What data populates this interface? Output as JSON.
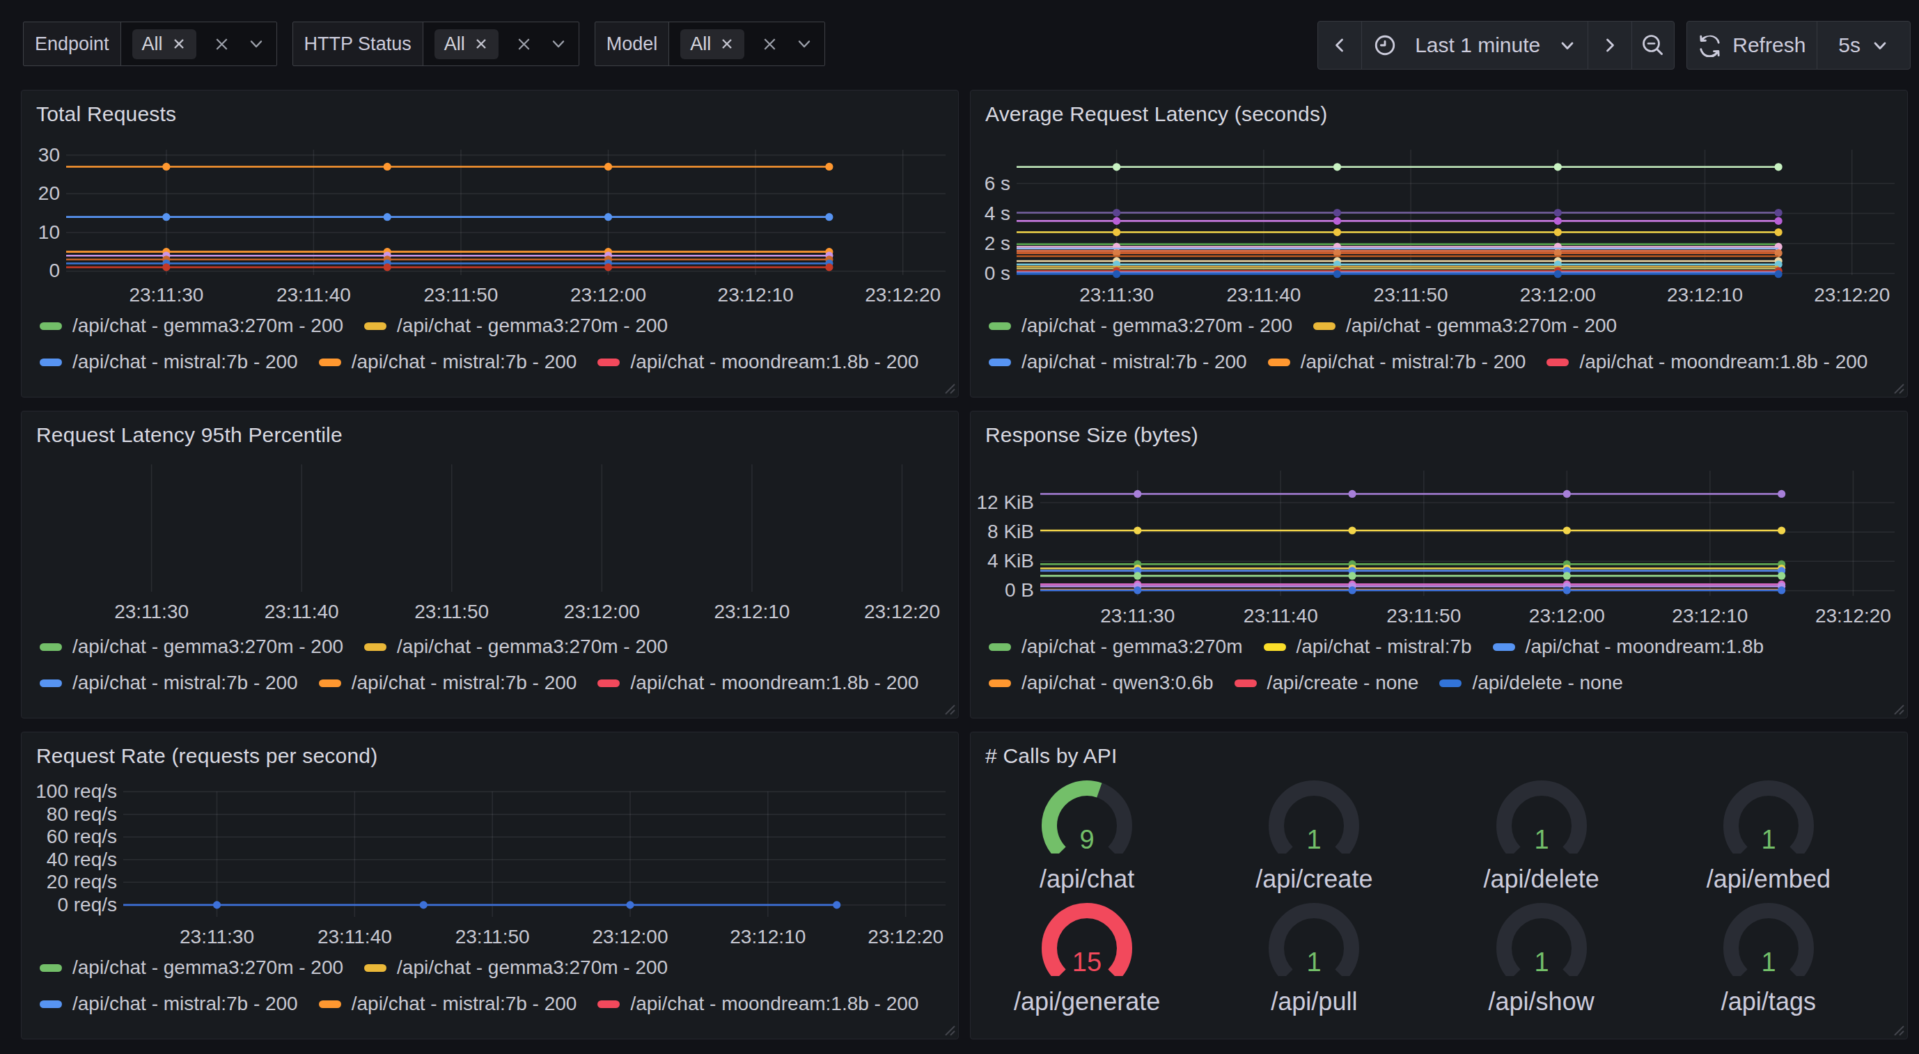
{
  "colors": {
    "page_bg": "#111217",
    "panel_bg": "#181B1F",
    "panel_border": "#25272E",
    "grid_line": "rgba(204,204,220,0.10)",
    "text": "#CCCCDC",
    "tick_text": "#C8C9D3",
    "green": "#73BF69",
    "red": "#F2495C"
  },
  "filters": [
    {
      "label": "Endpoint",
      "selected": "All"
    },
    {
      "label": "HTTP Status",
      "selected": "All"
    },
    {
      "label": "Model",
      "selected": "All"
    }
  ],
  "timebar": {
    "time_range": "Last 1 minute",
    "refresh_label": "Refresh",
    "interval": "5s"
  },
  "chart_data": [
    {
      "type": "line",
      "title": "Total Requests",
      "x_tick_labels": [
        "23:11:30",
        "23:11:40",
        "23:11:50",
        "23:12:00",
        "23:12:10",
        "23:12:20"
      ],
      "x_tick_times": [
        10,
        20,
        30,
        40,
        50,
        60
      ],
      "x_domain": [
        3.2,
        62.9
      ],
      "point_times": [
        10,
        25,
        40,
        55
      ],
      "point_labels": [
        "23:11:30",
        "23:11:45",
        "23:12:00",
        "23:12:15"
      ],
      "y_ticks": [
        {
          "v": 0,
          "label": "0"
        },
        {
          "v": 10,
          "label": "10"
        },
        {
          "v": 20,
          "label": "20"
        },
        {
          "v": 30,
          "label": "30"
        }
      ],
      "ylim": [
        -1.0,
        31.4
      ],
      "gutter": 64,
      "h_grid": true,
      "series": [
        {
          "color": "#FF9830",
          "value": 27
        },
        {
          "color": "#5794F2",
          "value": 14
        },
        {
          "color": "#FF9830",
          "value": 5.0
        },
        {
          "color": "#CA95E5",
          "value": 4.0
        },
        {
          "color": "#C9662B",
          "value": 3.0
        },
        {
          "color": "#3871CC",
          "value": 2.0
        },
        {
          "color": "#C23826",
          "value": 1.0
        }
      ],
      "legend_rows": [
        [
          {
            "color": "#73BF69",
            "label": "/api/chat - gemma3:270m - 200"
          },
          {
            "color": "#EAB839",
            "label": "/api/chat - gemma3:270m - 200"
          }
        ],
        [
          {
            "color": "#5794F2",
            "label": "/api/chat - mistral:7b - 200"
          },
          {
            "color": "#FF9830",
            "label": "/api/chat - mistral:7b - 200"
          },
          {
            "color": "#F2495C",
            "label": "/api/chat - moondream:1.8b - 200"
          }
        ]
      ]
    },
    {
      "type": "line",
      "title": "Average Request Latency (seconds)",
      "x_tick_labels": [
        "23:11:30",
        "23:11:40",
        "23:11:50",
        "23:12:00",
        "23:12:10",
        "23:12:20"
      ],
      "x_tick_times": [
        10,
        20,
        30,
        40,
        50,
        60
      ],
      "x_domain": [
        3.2,
        62.9
      ],
      "point_times": [
        10,
        25,
        40,
        55
      ],
      "point_labels": [
        "23:11:30",
        "23:11:45",
        "23:12:00",
        "23:12:15"
      ],
      "y_ticks": [
        {
          "v": 0,
          "label": "0 s"
        },
        {
          "v": 2,
          "label": "2 s"
        },
        {
          "v": 4,
          "label": "4 s"
        },
        {
          "v": 6,
          "label": "6 s"
        }
      ],
      "ylim": [
        -0.1,
        8.25
      ],
      "gutter": 66,
      "h_grid": true,
      "series": [
        {
          "color": "#C8F2C2",
          "value": 7.1
        },
        {
          "color": "#7661A1",
          "value": 4.05,
          "dot_color": "#5B4490"
        },
        {
          "color": "#C478DC",
          "value": 3.5,
          "dot_color": "#B75FD6"
        },
        {
          "color": "#F2D54A",
          "value": 2.75,
          "dot_color": "#EFC53D"
        },
        {
          "color": "#56A64B",
          "value": 1.95,
          "dots": false
        },
        {
          "color": "#EFB3DA",
          "value": 1.78
        },
        {
          "color": "#94B6F0",
          "value": 1.66,
          "dots": false
        },
        {
          "color": "#F2774A",
          "value": 1.5,
          "dots": false
        },
        {
          "color": "#E8682F",
          "value": 1.36,
          "dot_color": "#D97C45"
        },
        {
          "color": "#BF5B21",
          "value": 1.15,
          "dots": false
        },
        {
          "color": "#EDD7A4",
          "value": 0.83
        },
        {
          "color": "#6FC6DB",
          "value": 0.6
        },
        {
          "color": "#D4A73C",
          "value": 0.46,
          "dots": false
        },
        {
          "color": "#BFBC6B",
          "value": 0.33,
          "dots": false
        },
        {
          "color": "#C23B2B",
          "value": 0.17
        },
        {
          "color": "#9B86C7",
          "value": 0.08,
          "dots": false
        },
        {
          "color": "#4377D9",
          "value": 0.02,
          "dots": false
        },
        {
          "color": "#2159B5",
          "value": -0.04
        }
      ],
      "legend_rows": [
        [
          {
            "color": "#73BF69",
            "label": "/api/chat - gemma3:270m - 200"
          },
          {
            "color": "#EAB839",
            "label": "/api/chat - gemma3:270m - 200"
          }
        ],
        [
          {
            "color": "#5794F2",
            "label": "/api/chat - mistral:7b - 200"
          },
          {
            "color": "#FF9830",
            "label": "/api/chat - mistral:7b - 200"
          },
          {
            "color": "#F2495C",
            "label": "/api/chat - moondream:1.8b - 200"
          }
        ]
      ]
    },
    {
      "type": "line",
      "title": "Request Latency 95th Percentile",
      "x_tick_labels": [
        "23:11:30",
        "23:11:40",
        "23:11:50",
        "23:12:00",
        "23:12:10",
        "23:12:20"
      ],
      "x_tick_times": [
        10,
        20,
        30,
        40,
        50,
        60
      ],
      "x_domain": [
        3.2,
        62.9
      ],
      "point_times": [],
      "point_labels": [],
      "y_ticks": [],
      "ylim": [
        0,
        1
      ],
      "gutter": 40,
      "pt": 76,
      "pb": 259,
      "h_grid": false,
      "series": [],
      "legend_rows": [
        [
          {
            "color": "#73BF69",
            "label": "/api/chat - gemma3:270m - 200"
          },
          {
            "color": "#EAB839",
            "label": "/api/chat - gemma3:270m - 200"
          }
        ],
        [
          {
            "color": "#5794F2",
            "label": "/api/chat - mistral:7b - 200"
          },
          {
            "color": "#FF9830",
            "label": "/api/chat - mistral:7b - 200"
          },
          {
            "color": "#F2495C",
            "label": "/api/chat - moondream:1.8b - 200"
          }
        ]
      ]
    },
    {
      "type": "line",
      "title": "Response Size (bytes)",
      "x_tick_labels": [
        "23:11:30",
        "23:11:40",
        "23:11:50",
        "23:12:00",
        "23:12:10",
        "23:12:20"
      ],
      "x_tick_times": [
        10,
        20,
        30,
        40,
        50,
        60
      ],
      "x_domain": [
        3.2,
        62.9
      ],
      "point_times": [
        10,
        25,
        40,
        55
      ],
      "point_labels": [
        "23:11:30",
        "23:11:45",
        "23:12:00",
        "23:12:15"
      ],
      "y_ticks": [
        {
          "v": 0,
          "label": "0 B"
        },
        {
          "v": 4096,
          "label": "4 KiB"
        },
        {
          "v": 8192,
          "label": "8 KiB"
        },
        {
          "v": 12288,
          "label": "12 KiB"
        }
      ],
      "ylim": [
        -730,
        16750
      ],
      "gutter": 100,
      "h_grid": true,
      "series": [
        {
          "color": "#A77FD9",
          "value": 13500
        },
        {
          "color": "#F2D54A",
          "value": 8400
        },
        {
          "color": "#5FA653",
          "value": 3700
        },
        {
          "color": "#EDD54C",
          "value": 3100
        },
        {
          "color": "#5285E8",
          "value": 2780
        },
        {
          "color": "#96D98D",
          "value": 2070
        },
        {
          "color": "#D96BC9",
          "value": 880
        },
        {
          "color": "#B990E8",
          "value": 600
        },
        {
          "color": "#FF9830",
          "value": 140,
          "dots": false
        },
        {
          "color": "#3D71D9",
          "value": 50
        }
      ],
      "legend_rows": [
        [
          {
            "color": "#73BF69",
            "label": "/api/chat - gemma3:270m"
          },
          {
            "color": "#FADE2A",
            "label": "/api/chat - mistral:7b"
          },
          {
            "color": "#5794F2",
            "label": "/api/chat - moondream:1.8b"
          }
        ],
        [
          {
            "color": "#FF9830",
            "label": "/api/chat - qwen3:0.6b"
          },
          {
            "color": "#F2495C",
            "label": "/api/create - none"
          },
          {
            "color": "#3274D9",
            "label": "/api/delete - none"
          }
        ]
      ]
    },
    {
      "type": "line",
      "title": "Request Rate (requests per second)",
      "x_tick_labels": [
        "23:11:30",
        "23:11:40",
        "23:11:50",
        "23:12:00",
        "23:12:10",
        "23:12:20"
      ],
      "x_tick_times": [
        10,
        20,
        30,
        40,
        50,
        60
      ],
      "x_domain": [
        3.2,
        62.9
      ],
      "point_times": [
        10,
        25,
        40,
        55
      ],
      "point_labels": [
        "23:11:30",
        "23:11:45",
        "23:12:00",
        "23:12:15"
      ],
      "y_ticks": [
        {
          "v": 0,
          "label": "0 req/s"
        },
        {
          "v": 20,
          "label": "20 req/s"
        },
        {
          "v": 40,
          "label": "40 req/s"
        },
        {
          "v": 60,
          "label": "60 req/s"
        },
        {
          "v": 80,
          "label": "80 req/s"
        },
        {
          "v": 100,
          "label": "100 req/s"
        }
      ],
      "ylim": [
        -10.5,
        100.1
      ],
      "gutter": 146,
      "h_grid": true,
      "series": [
        {
          "color": "#3D71D9",
          "value": 0
        }
      ],
      "legend_rows": [
        [
          {
            "color": "#73BF69",
            "label": "/api/chat - gemma3:270m - 200"
          },
          {
            "color": "#EAB839",
            "label": "/api/chat - gemma3:270m - 200"
          }
        ],
        [
          {
            "color": "#5794F2",
            "label": "/api/chat - mistral:7b - 200"
          },
          {
            "color": "#FF9830",
            "label": "/api/chat - mistral:7b - 200"
          },
          {
            "color": "#F2495C",
            "label": "/api/chat - moondream:1.8b - 200"
          }
        ]
      ]
    },
    {
      "type": "gauge",
      "title": "# Calls by API",
      "min": 1,
      "max": 15,
      "gauges": [
        {
          "label": "/api/chat",
          "value": 9,
          "color": "#73BF69"
        },
        {
          "label": "/api/create",
          "value": 1,
          "color": "#73BF69"
        },
        {
          "label": "/api/delete",
          "value": 1,
          "color": "#73BF69"
        },
        {
          "label": "/api/embed",
          "value": 1,
          "color": "#73BF69"
        },
        {
          "label": "/api/generate",
          "value": 15,
          "color": "#F2495C"
        },
        {
          "label": "/api/pull",
          "value": 1,
          "color": "#73BF69"
        },
        {
          "label": "/api/show",
          "value": 1,
          "color": "#73BF69"
        },
        {
          "label": "/api/tags",
          "value": 1,
          "color": "#73BF69"
        }
      ],
      "track_color": "#292C34"
    }
  ]
}
